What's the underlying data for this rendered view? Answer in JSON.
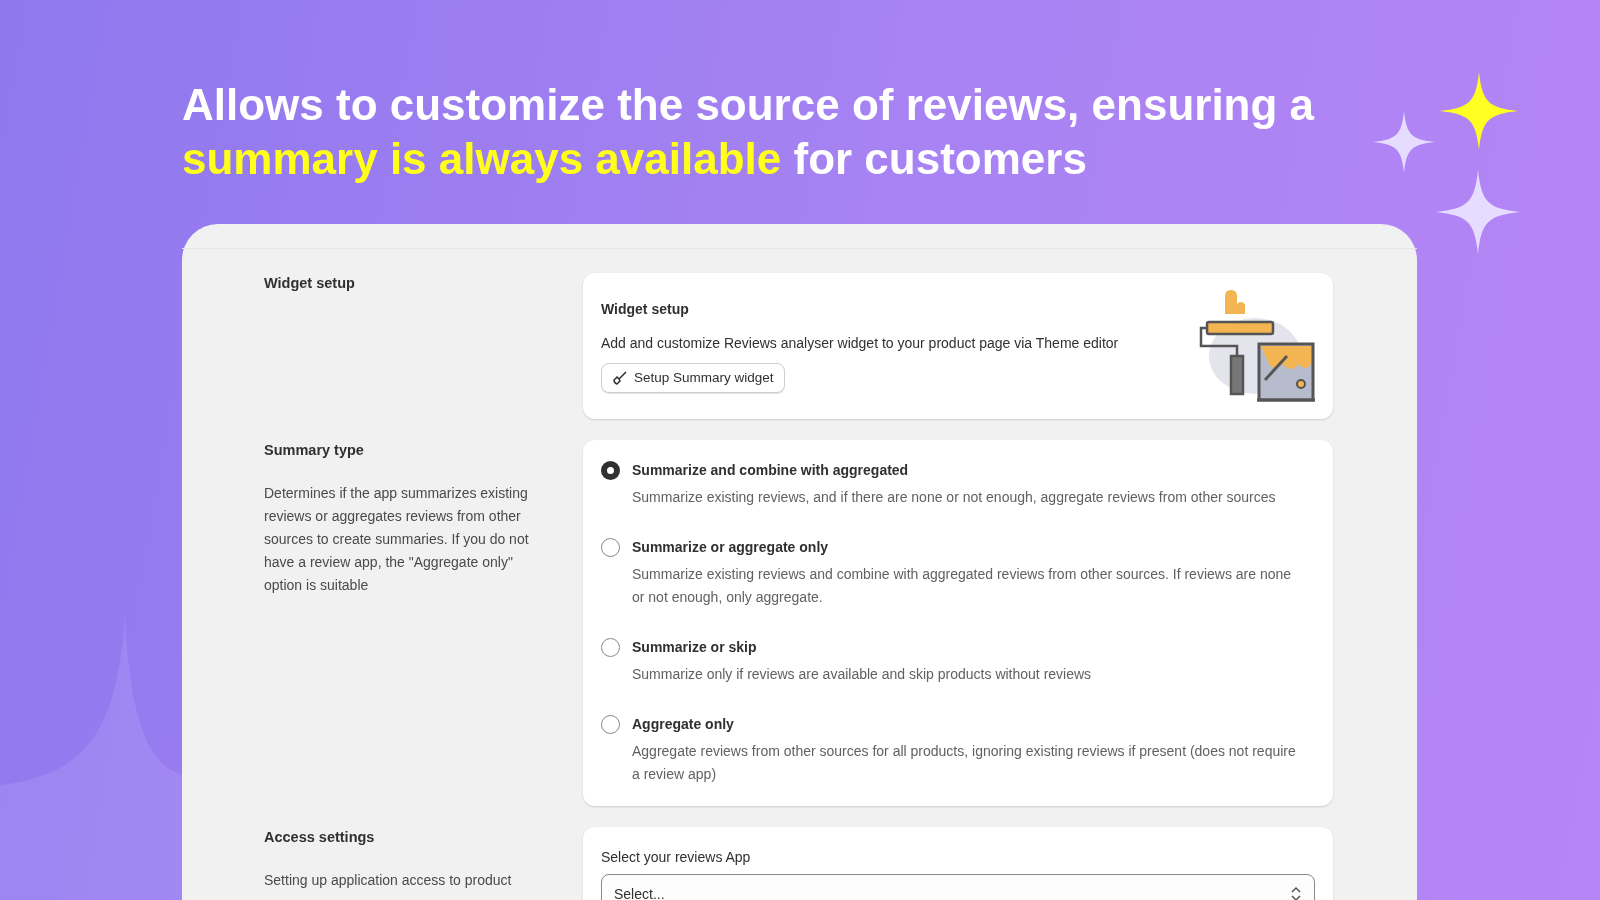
{
  "headline": {
    "text_before": "Allows to customize the source of reviews, ensuring a ",
    "highlight": "summary is always available",
    "text_after": " for customers"
  },
  "sections": [
    {
      "kind": "widget",
      "label": "Widget setup",
      "card": {
        "title": "Widget setup",
        "description": "Add and customize Reviews analyser widget to your product page via Theme editor",
        "button": "Setup Summary widget"
      }
    },
    {
      "kind": "radio",
      "label": "Summary type",
      "description": "Determines if the app summarizes existing reviews or aggregates reviews from other sources to create summaries. If you do not have a review app, the \"Aggregate only\" option is suitable",
      "options": [
        {
          "title": "Summarize and combine with aggregated",
          "description": "Summarize existing reviews, and if there are none or not enough, aggregate reviews from other sources",
          "selected": true
        },
        {
          "title": "Summarize or aggregate only",
          "description": "Summarize existing reviews and combine with aggregated reviews from other sources. If reviews are none or not enough, only aggregate.",
          "selected": false
        },
        {
          "title": "Summarize or skip",
          "description": "Summarize only if reviews are available and skip products without reviews",
          "selected": false
        },
        {
          "title": "Aggregate only",
          "description": "Aggregate reviews from other sources for all products, ignoring existing reviews if present (does not require a review app)",
          "selected": false
        }
      ]
    },
    {
      "kind": "select",
      "label": "Access settings",
      "description": "Setting up application access to product",
      "field_label": "Select your reviews App",
      "placeholder": "Select..."
    }
  ]
}
